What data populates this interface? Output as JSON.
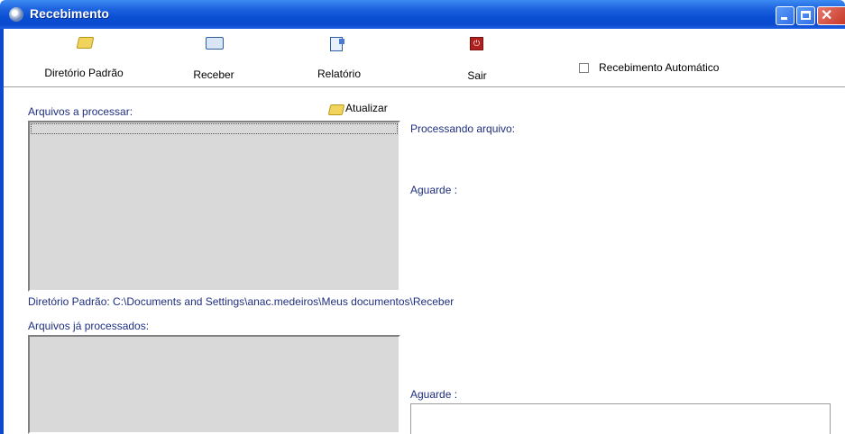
{
  "window": {
    "title": "Recebimento"
  },
  "toolbar": {
    "default_dir_label": "Diretório Padrão",
    "receive_label": "Receber",
    "report_label": "Relatório",
    "exit_label": "Sair",
    "auto_receive_label": "Recebimento Automático",
    "auto_receive_checked": false
  },
  "main": {
    "pending_label": "Arquivos a processar:",
    "refresh_label": "Atualizar",
    "processing_label": "Processando arquivo:",
    "wait_label_1": "Aguarde :",
    "default_dir_text": "Diretório Padrão: C:\\Documents and Settings\\anac.medeiros\\Meus documentos\\Receber",
    "processed_label": "Arquivos já processados:",
    "wait_label_2": "Aguarde :"
  },
  "colors": {
    "titlebar": "#0b4ad0",
    "label_text": "#1f2f80",
    "listbox_bg": "#d9d9d9",
    "close_button": "#c6392a"
  }
}
